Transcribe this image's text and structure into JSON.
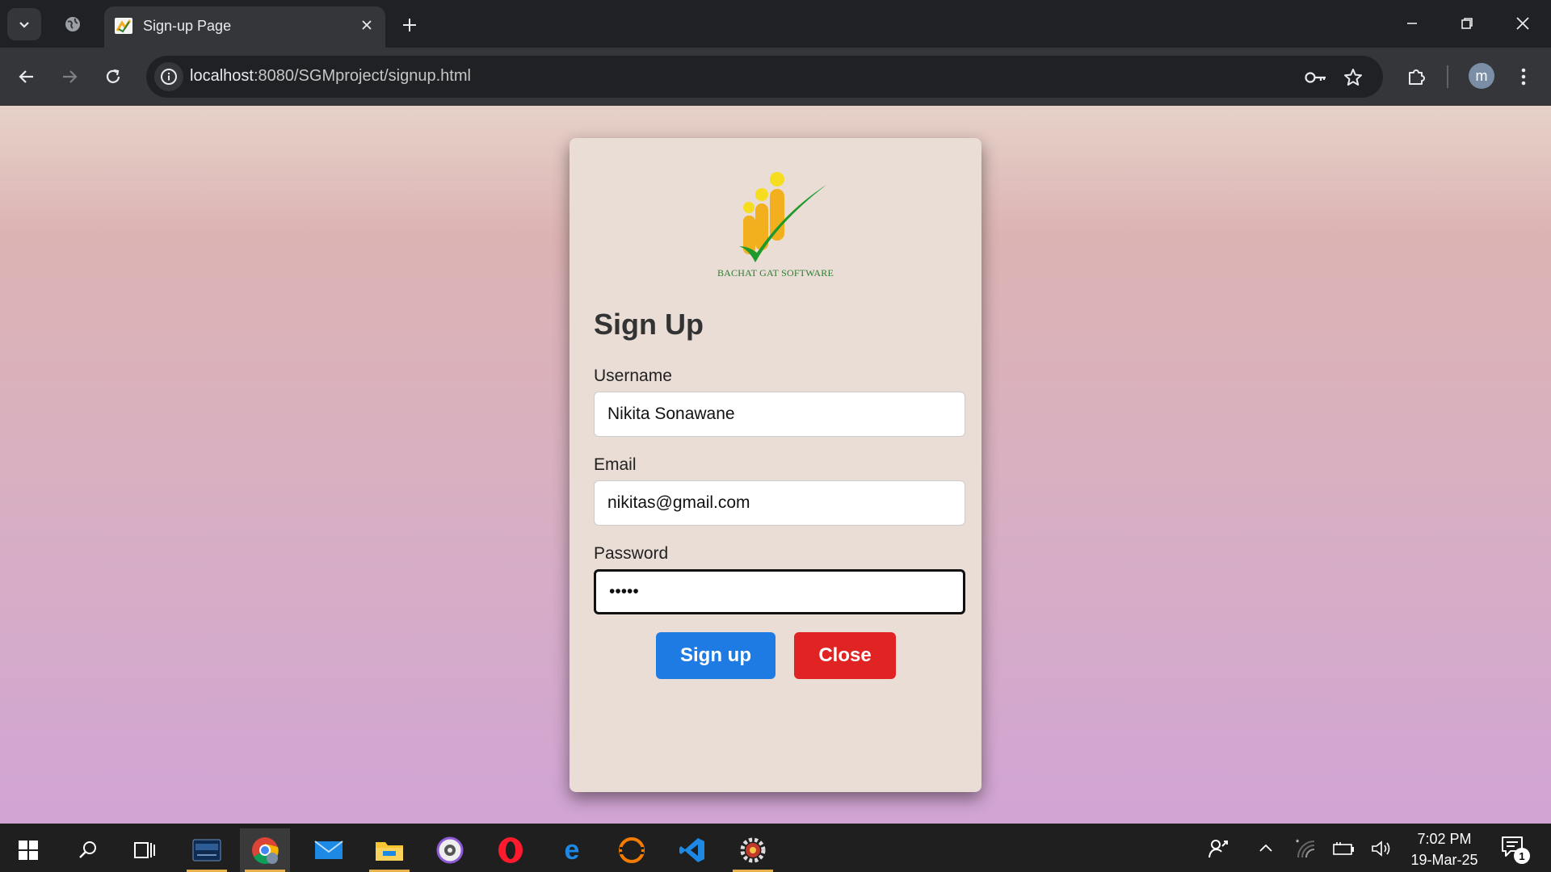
{
  "browser": {
    "tab_title": "Sign-up Page",
    "url_host": "localhost",
    "url_path": ":8080/SGMproject/signup.html",
    "profile_initial": "m"
  },
  "page": {
    "logo_text": "BACHAT GAT SOFTWARE",
    "title": "Sign Up",
    "username_label": "Username",
    "username_value": "Nikita Sonawane",
    "email_label": "Email",
    "email_value": "nikitas@gmail.com",
    "password_label": "Password",
    "password_value": "•••••",
    "signup_button": "Sign up",
    "close_button": "Close"
  },
  "taskbar": {
    "time": "7:02 PM",
    "date": "19-Mar-25",
    "notification_count": "1",
    "apps": [
      "mysql-workbench-icon",
      "chrome-icon",
      "mail-icon",
      "file-explorer-icon",
      "media-player-icon",
      "opera-icon",
      "edge-icon",
      "eclipse-icon",
      "vscode-icon",
      "settings-app-icon"
    ]
  },
  "colors": {
    "signup_button": "#1e7be3",
    "close_button": "#e02323",
    "card_background": "#e9ddd5",
    "logo_green": "#2e7d32",
    "logo_yellow": "#f2b01e"
  }
}
